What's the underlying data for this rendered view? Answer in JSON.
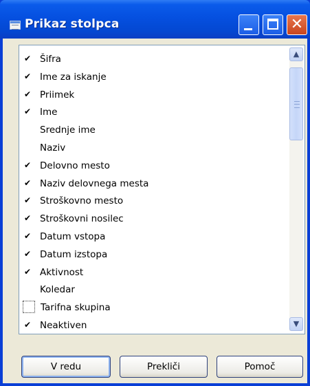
{
  "window": {
    "title": "Prikaz stolpca"
  },
  "titlebar_buttons": {
    "minimize": "minimize-icon",
    "maximize": "maximize-icon",
    "close": "close-icon"
  },
  "columns": [
    {
      "label": "Šifra",
      "checked": true
    },
    {
      "label": "Ime za iskanje",
      "checked": true
    },
    {
      "label": "Priimek",
      "checked": true
    },
    {
      "label": "Ime",
      "checked": true
    },
    {
      "label": "Srednje ime",
      "checked": false
    },
    {
      "label": "Naziv",
      "checked": false
    },
    {
      "label": "Delovno mesto",
      "checked": true
    },
    {
      "label": "Naziv delovnega mesta",
      "checked": true
    },
    {
      "label": "Stroškovno mesto",
      "checked": true
    },
    {
      "label": "Stroškovni nosilec",
      "checked": true
    },
    {
      "label": "Datum vstopa",
      "checked": true
    },
    {
      "label": "Datum izstopa",
      "checked": true
    },
    {
      "label": "Aktivnost",
      "checked": true
    },
    {
      "label": "Koledar",
      "checked": false
    },
    {
      "label": "Tarifna skupina",
      "checked": false,
      "focused": true
    },
    {
      "label": "Neaktiven",
      "checked": true
    }
  ],
  "buttons": {
    "ok": "V redu",
    "cancel": "Prekliči",
    "help": "Pomoč"
  },
  "colors": {
    "titlebar": "#0550e0",
    "close": "#c9461f",
    "dialog": "#ece9d8"
  }
}
